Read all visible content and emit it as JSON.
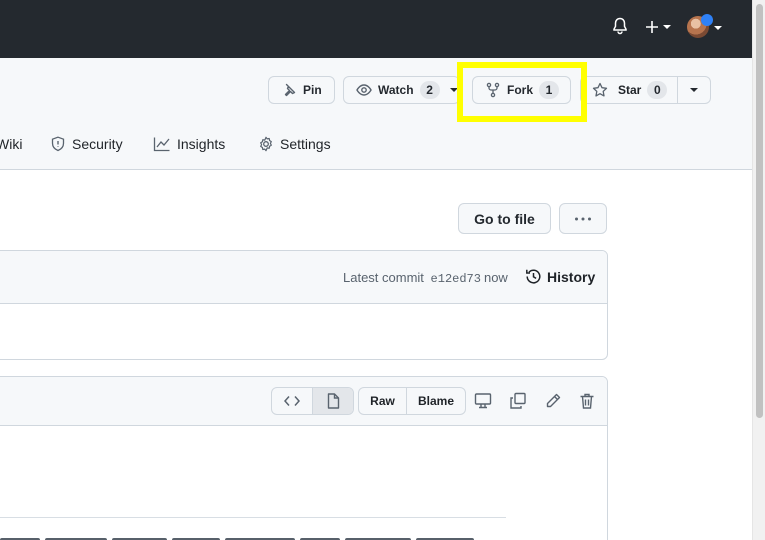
{
  "header": {
    "icons": [
      "bell-icon",
      "plus-icon",
      "avatar"
    ]
  },
  "repo_actions": {
    "pin_label": "Pin",
    "watch_label": "Watch",
    "watch_count": "2",
    "fork_label": "Fork",
    "fork_count": "1",
    "star_label": "Star",
    "star_count": "0"
  },
  "tabs": [
    {
      "label": "Wiki"
    },
    {
      "label": "Security"
    },
    {
      "label": "Insights"
    },
    {
      "label": "Settings"
    }
  ],
  "file_nav": {
    "goto_label": "Go to file"
  },
  "commit": {
    "prefix": "Latest commit",
    "sha": "e12ed73",
    "time": "now",
    "history_label": "History"
  },
  "file_view": {
    "raw_label": "Raw",
    "blame_label": "Blame"
  },
  "colors": {
    "header_bg": "#24292f",
    "highlight": "#ffff00",
    "border": "#d0d7de"
  }
}
